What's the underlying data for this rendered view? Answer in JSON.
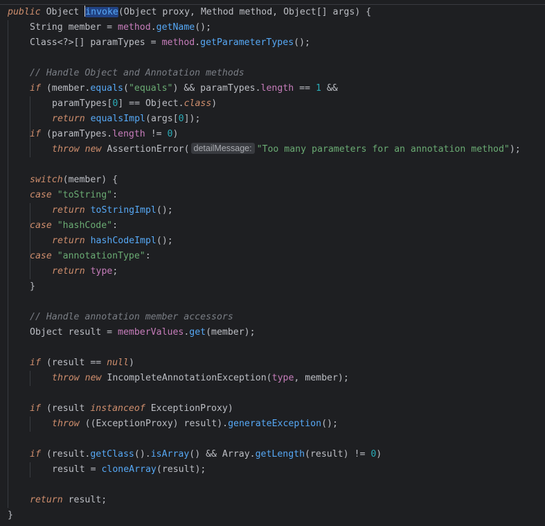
{
  "editor": {
    "lines": [
      {
        "indent": 0,
        "tokens": [
          {
            "t": "public",
            "c": "kw"
          },
          {
            "t": " "
          },
          {
            "t": "Object",
            "c": "cls"
          },
          {
            "t": " "
          },
          {
            "caret": true
          },
          {
            "t": "invoke",
            "c": "fn hl"
          },
          {
            "t": "(",
            "c": "cls"
          },
          {
            "t": "Object",
            "c": "cls"
          },
          {
            "t": " proxy, ",
            "c": "cls"
          },
          {
            "t": "Method",
            "c": "cls"
          },
          {
            "t": " method, ",
            "c": "cls"
          },
          {
            "t": "Object[]",
            "c": "cls"
          },
          {
            "t": " args) {",
            "c": "cls"
          }
        ]
      },
      {
        "indent": 1,
        "tokens": [
          {
            "t": "String",
            "c": "cls"
          },
          {
            "t": " member = ",
            "c": "cls"
          },
          {
            "t": "method",
            "c": "field"
          },
          {
            "t": ".",
            "c": "cls"
          },
          {
            "t": "getName",
            "c": "fn"
          },
          {
            "t": "();",
            "c": "cls"
          }
        ]
      },
      {
        "indent": 1,
        "tokens": [
          {
            "t": "Class<?>[]",
            "c": "cls"
          },
          {
            "t": " paramTypes = ",
            "c": "cls"
          },
          {
            "t": "method",
            "c": "field"
          },
          {
            "t": ".",
            "c": "cls"
          },
          {
            "t": "getParameterTypes",
            "c": "fn"
          },
          {
            "t": "();",
            "c": "cls"
          }
        ]
      },
      {
        "indent": 1,
        "tokens": []
      },
      {
        "indent": 1,
        "tokens": [
          {
            "t": "// Handle Object and Annotation methods",
            "c": "cmt"
          }
        ]
      },
      {
        "indent": 1,
        "tokens": [
          {
            "t": "if",
            "c": "kw"
          },
          {
            "t": " (member.",
            "c": "cls"
          },
          {
            "t": "equals",
            "c": "fn"
          },
          {
            "t": "(",
            "c": "cls"
          },
          {
            "t": "\"equals\"",
            "c": "str"
          },
          {
            "t": ") && paramTypes.",
            "c": "cls"
          },
          {
            "t": "length",
            "c": "field"
          },
          {
            "t": " == ",
            "c": "cls"
          },
          {
            "t": "1",
            "c": "num"
          },
          {
            "t": " &&",
            "c": "cls"
          }
        ]
      },
      {
        "indent": 2,
        "tokens": [
          {
            "t": "paramTypes[",
            "c": "cls"
          },
          {
            "t": "0",
            "c": "num"
          },
          {
            "t": "] == Object.",
            "c": "cls"
          },
          {
            "t": "class",
            "c": "kw"
          },
          {
            "t": ")",
            "c": "cls"
          }
        ]
      },
      {
        "indent": 2,
        "tokens": [
          {
            "t": "return",
            "c": "kw"
          },
          {
            "t": " ",
            "c": "cls"
          },
          {
            "t": "equalsImpl",
            "c": "fn"
          },
          {
            "t": "(args[",
            "c": "cls"
          },
          {
            "t": "0",
            "c": "num"
          },
          {
            "t": "]);",
            "c": "cls"
          }
        ]
      },
      {
        "indent": 1,
        "tokens": [
          {
            "t": "if",
            "c": "kw"
          },
          {
            "t": " (paramTypes.",
            "c": "cls"
          },
          {
            "t": "length",
            "c": "field"
          },
          {
            "t": " != ",
            "c": "cls"
          },
          {
            "t": "0",
            "c": "num"
          },
          {
            "t": ")",
            "c": "cls"
          }
        ]
      },
      {
        "indent": 2,
        "tokens": [
          {
            "t": "throw",
            "c": "kw"
          },
          {
            "t": " ",
            "c": "cls"
          },
          {
            "t": "new",
            "c": "kw"
          },
          {
            "t": " AssertionError(",
            "c": "cls"
          },
          {
            "hint": "detailMessage:"
          },
          {
            "t": "\"Too many parameters for an annotation method\"",
            "c": "str"
          },
          {
            "t": ");",
            "c": "cls"
          }
        ]
      },
      {
        "indent": 1,
        "tokens": []
      },
      {
        "indent": 1,
        "tokens": [
          {
            "t": "switch",
            "c": "kw"
          },
          {
            "t": "(member) {",
            "c": "cls"
          }
        ]
      },
      {
        "indent": 1,
        "tokens": [
          {
            "t": "case",
            "c": "kw"
          },
          {
            "t": " ",
            "c": "cls"
          },
          {
            "t": "\"toString\"",
            "c": "str"
          },
          {
            "t": ":",
            "c": "cls"
          }
        ]
      },
      {
        "indent": 2,
        "tokens": [
          {
            "t": "return",
            "c": "kw"
          },
          {
            "t": " ",
            "c": "cls"
          },
          {
            "t": "toStringImpl",
            "c": "fn"
          },
          {
            "t": "();",
            "c": "cls"
          }
        ]
      },
      {
        "indent": 1,
        "tokens": [
          {
            "t": "case",
            "c": "kw"
          },
          {
            "t": " ",
            "c": "cls"
          },
          {
            "t": "\"hashCode\"",
            "c": "str"
          },
          {
            "t": ":",
            "c": "cls"
          }
        ]
      },
      {
        "indent": 2,
        "tokens": [
          {
            "t": "return",
            "c": "kw"
          },
          {
            "t": " ",
            "c": "cls"
          },
          {
            "t": "hashCodeImpl",
            "c": "fn"
          },
          {
            "t": "();",
            "c": "cls"
          }
        ]
      },
      {
        "indent": 1,
        "tokens": [
          {
            "t": "case",
            "c": "kw"
          },
          {
            "t": " ",
            "c": "cls"
          },
          {
            "t": "\"annotationType\"",
            "c": "str"
          },
          {
            "t": ":",
            "c": "cls"
          }
        ]
      },
      {
        "indent": 2,
        "tokens": [
          {
            "t": "return",
            "c": "kw"
          },
          {
            "t": " ",
            "c": "cls"
          },
          {
            "t": "type",
            "c": "field"
          },
          {
            "t": ";",
            "c": "cls"
          }
        ]
      },
      {
        "indent": 1,
        "tokens": [
          {
            "t": "}",
            "c": "cls"
          }
        ]
      },
      {
        "indent": 1,
        "tokens": []
      },
      {
        "indent": 1,
        "tokens": [
          {
            "t": "// Handle annotation member accessors",
            "c": "cmt"
          }
        ]
      },
      {
        "indent": 1,
        "tokens": [
          {
            "t": "Object",
            "c": "cls"
          },
          {
            "t": " result = ",
            "c": "cls"
          },
          {
            "t": "memberValues",
            "c": "field"
          },
          {
            "t": ".",
            "c": "cls"
          },
          {
            "t": "get",
            "c": "fn"
          },
          {
            "t": "(member);",
            "c": "cls"
          }
        ]
      },
      {
        "indent": 1,
        "tokens": []
      },
      {
        "indent": 1,
        "tokens": [
          {
            "t": "if",
            "c": "kw"
          },
          {
            "t": " (result == ",
            "c": "cls"
          },
          {
            "t": "null",
            "c": "kw"
          },
          {
            "t": ")",
            "c": "cls"
          }
        ]
      },
      {
        "indent": 2,
        "tokens": [
          {
            "t": "throw",
            "c": "kw"
          },
          {
            "t": " ",
            "c": "cls"
          },
          {
            "t": "new",
            "c": "kw"
          },
          {
            "t": " IncompleteAnnotationException(",
            "c": "cls"
          },
          {
            "t": "type",
            "c": "field"
          },
          {
            "t": ", member);",
            "c": "cls"
          }
        ]
      },
      {
        "indent": 1,
        "tokens": []
      },
      {
        "indent": 1,
        "tokens": [
          {
            "t": "if",
            "c": "kw"
          },
          {
            "t": " (result ",
            "c": "cls"
          },
          {
            "t": "instanceof",
            "c": "kw"
          },
          {
            "t": " ExceptionProxy)",
            "c": "cls"
          }
        ]
      },
      {
        "indent": 2,
        "tokens": [
          {
            "t": "throw",
            "c": "kw"
          },
          {
            "t": " ((ExceptionProxy) result).",
            "c": "cls"
          },
          {
            "t": "generateException",
            "c": "fn"
          },
          {
            "t": "();",
            "c": "cls"
          }
        ]
      },
      {
        "indent": 1,
        "tokens": []
      },
      {
        "indent": 1,
        "tokens": [
          {
            "t": "if",
            "c": "kw"
          },
          {
            "t": " (result.",
            "c": "cls"
          },
          {
            "t": "getClass",
            "c": "fn"
          },
          {
            "t": "().",
            "c": "cls"
          },
          {
            "t": "isArray",
            "c": "fn"
          },
          {
            "t": "() && Array.",
            "c": "cls"
          },
          {
            "t": "getLength",
            "c": "fn"
          },
          {
            "t": "(result) != ",
            "c": "cls"
          },
          {
            "t": "0",
            "c": "num"
          },
          {
            "t": ")",
            "c": "cls"
          }
        ]
      },
      {
        "indent": 2,
        "tokens": [
          {
            "t": "result = ",
            "c": "cls"
          },
          {
            "t": "cloneArray",
            "c": "fn"
          },
          {
            "t": "(result);",
            "c": "cls"
          }
        ]
      },
      {
        "indent": 1,
        "tokens": []
      },
      {
        "indent": 1,
        "tokens": [
          {
            "t": "return",
            "c": "kw"
          },
          {
            "t": " result;",
            "c": "cls"
          }
        ]
      },
      {
        "indent": 0,
        "tokens": [
          {
            "t": "}",
            "c": "cls"
          }
        ]
      }
    ]
  },
  "colors": {
    "background": "#1e1f22",
    "keyword": "#cf8e6d",
    "function": "#56a8f5",
    "field": "#c77dbb",
    "string": "#6aab73",
    "number": "#2aacb8",
    "comment": "#7a7e85",
    "text": "#bcbec4"
  }
}
